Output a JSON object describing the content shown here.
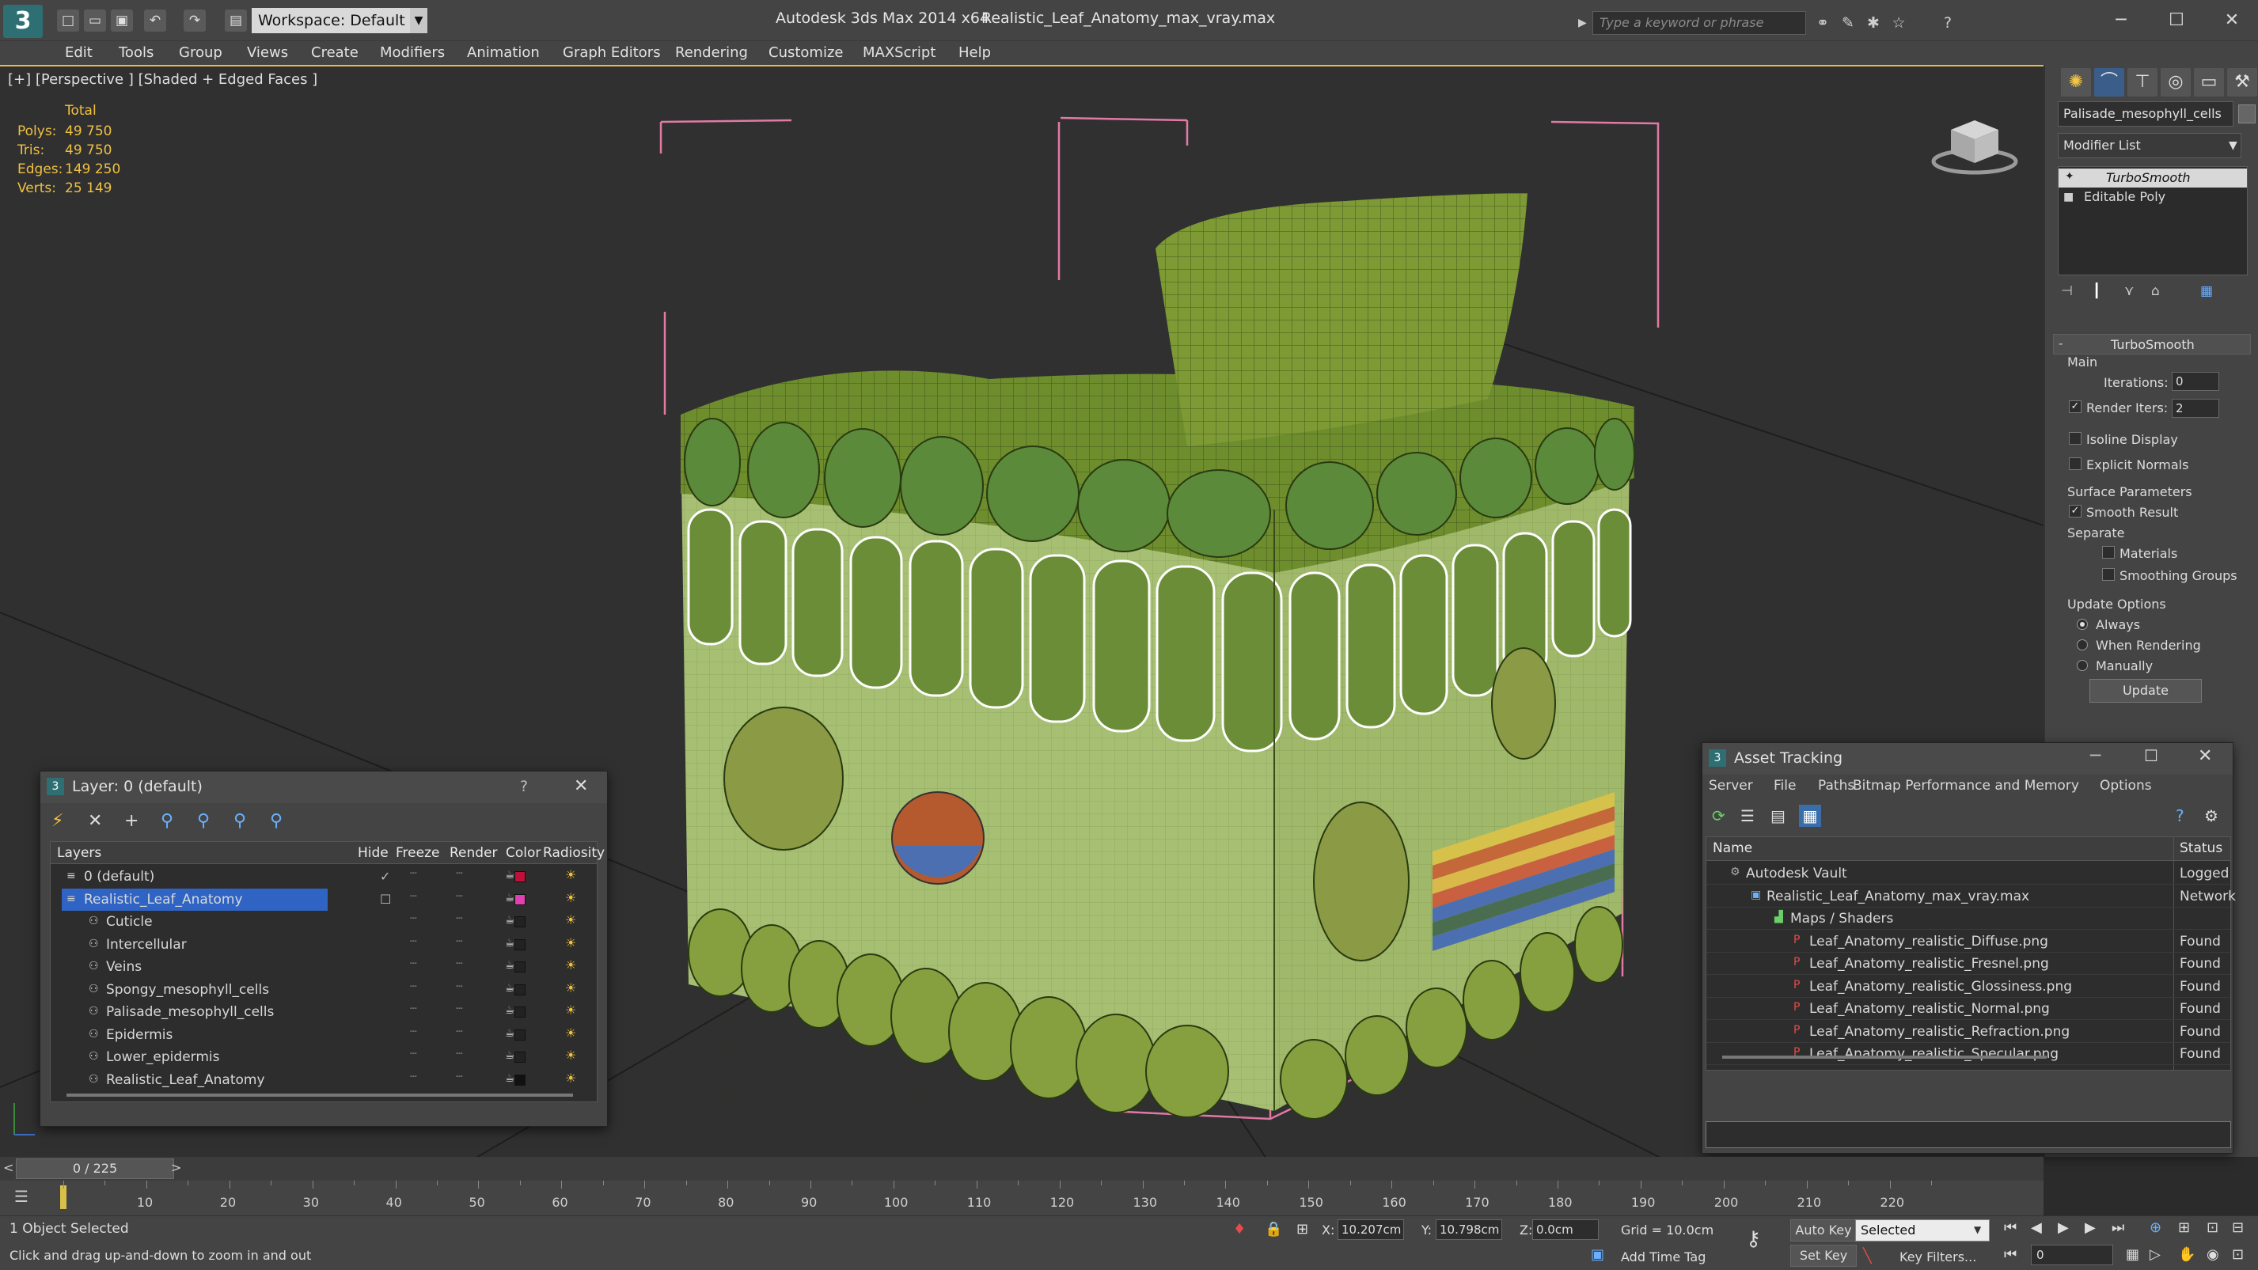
{
  "title_bar": {
    "app_title": "Autodesk 3ds Max  2014 x64",
    "file_name": "Realistic_Leaf_Anatomy_max_vray.max",
    "workspace": "Workspace: Default",
    "search_placeholder": "Type a keyword or phrase"
  },
  "menu": [
    "Edit",
    "Tools",
    "Group",
    "Views",
    "Create",
    "Modifiers",
    "Animation",
    "Graph Editors",
    "Rendering",
    "Customize",
    "MAXScript",
    "Help"
  ],
  "viewport": {
    "label": "[+] [Perspective ] [Shaded + Edged Faces ]",
    "stats": {
      "header": "Total",
      "rows": [
        {
          "label": "Polys:",
          "value": "49 750"
        },
        {
          "label": "Tris:",
          "value": "49 750"
        },
        {
          "label": "Edges:",
          "value": "149 250"
        },
        {
          "label": "Verts:",
          "value": "25 149"
        }
      ]
    }
  },
  "command_panel": {
    "object_name": "Palisade_mesophyll_cells",
    "modifier_list": "Modifier List",
    "stack": [
      "TurboSmooth",
      "Editable Poly"
    ],
    "rollout_title": "TurboSmooth",
    "main_label": "Main",
    "iterations_label": "Iterations:",
    "iterations_value": "0",
    "render_iters_label": "Render Iters:",
    "render_iters_value": "2",
    "isoline": "Isoline Display",
    "explicit_normals": "Explicit Normals",
    "surface_params": "Surface Parameters",
    "smooth_result": "Smooth Result",
    "separate": "Separate",
    "materials": "Materials",
    "smoothing_groups": "Smoothing Groups",
    "update_options": "Update Options",
    "always": "Always",
    "when_rendering": "When Rendering",
    "manually": "Manually",
    "update_button": "Update"
  },
  "layer_dialog": {
    "title": "Layer: 0 (default)",
    "help": "?",
    "close": "✕",
    "columns": [
      "Layers",
      "Hide",
      "Freeze",
      "Render",
      "Color",
      "Radiosity"
    ],
    "rows": [
      {
        "name": "0 (default)",
        "color": "#c0103a"
      },
      {
        "name": "Realistic_Leaf_Anatomy",
        "color": "#e040b0"
      },
      {
        "name": "Cuticle",
        "color": "#222222"
      },
      {
        "name": "Intercellular",
        "color": "#222222"
      },
      {
        "name": "Veins",
        "color": "#222222"
      },
      {
        "name": "Spongy_mesophyll_cells",
        "color": "#222222"
      },
      {
        "name": "Palisade_mesophyll_cells",
        "color": "#222222"
      },
      {
        "name": "Epidermis",
        "color": "#222222"
      },
      {
        "name": "Lower_epidermis",
        "color": "#222222"
      },
      {
        "name": "Realistic_Leaf_Anatomy",
        "color": "#111111"
      }
    ]
  },
  "asset_dialog": {
    "title": "Asset Tracking",
    "menu": [
      "Server",
      "File",
      "Paths",
      "Bitmap Performance and Memory",
      "Options"
    ],
    "columns": [
      "Name",
      "Status"
    ],
    "rows": [
      {
        "name": "Autodesk Vault",
        "status": "Logged"
      },
      {
        "name": "Realistic_Leaf_Anatomy_max_vray.max",
        "status": "Network"
      },
      {
        "name": "Maps / Shaders",
        "status": ""
      },
      {
        "name": "Leaf_Anatomy_realistic_Diffuse.png",
        "status": "Found"
      },
      {
        "name": "Leaf_Anatomy_realistic_Fresnel.png",
        "status": "Found"
      },
      {
        "name": "Leaf_Anatomy_realistic_Glossiness.png",
        "status": "Found"
      },
      {
        "name": "Leaf_Anatomy_realistic_Normal.png",
        "status": "Found"
      },
      {
        "name": "Leaf_Anatomy_realistic_Refraction.png",
        "status": "Found"
      },
      {
        "name": "Leaf_Anatomy_realistic_Specular.png",
        "status": "Found"
      }
    ]
  },
  "timeline": {
    "frame": "0 / 225",
    "ticks": [
      "10",
      "20",
      "30",
      "40",
      "50",
      "60",
      "70",
      "80",
      "90",
      "100",
      "110",
      "120",
      "130",
      "140",
      "150",
      "160",
      "170",
      "180",
      "190",
      "200",
      "210",
      "220"
    ]
  },
  "status_bar": {
    "selection": "1 Object Selected",
    "prompt": "Click and drag up-and-down to zoom in and out",
    "x_label": "X:",
    "x_value": "10.207cm",
    "y_label": "Y:",
    "y_value": "10.798cm",
    "z_label": "Z:",
    "z_value": "0.0cm",
    "grid": "Grid = 10.0cm",
    "add_time_tag": "Add Time Tag",
    "auto_key": "Auto Key",
    "set_key": "Set Key",
    "selected": "Selected",
    "key_filters": "Key Filters...",
    "frame_value": "0"
  }
}
